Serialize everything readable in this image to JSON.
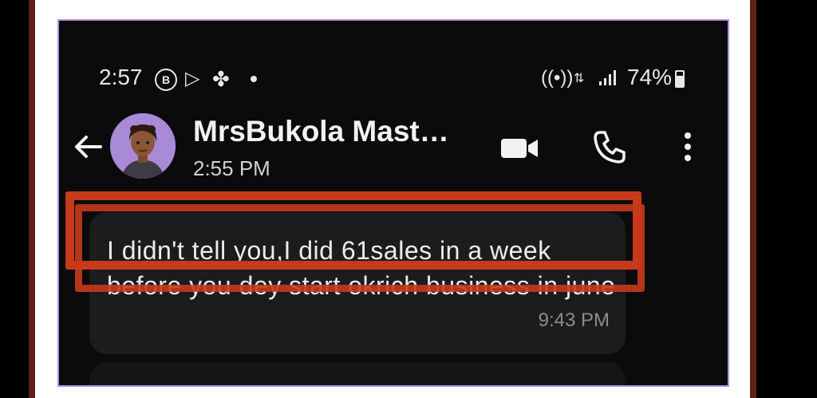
{
  "status_bar": {
    "time": "2:57",
    "notification_icons": [
      "b-circle-icon",
      "play-store-icon",
      "fan-icon",
      "dot-icon"
    ],
    "system_icons": [
      "hotspot-icon",
      "data-arrows-icon",
      "signal-icon"
    ],
    "battery_percent": "74%",
    "battery_level": 0.74
  },
  "chat_header": {
    "contact_name": "MrsBukola Mast…",
    "last_seen": "2:55 PM"
  },
  "message": {
    "text": "I didn't tell you,I did 61sales in a week before you dey start okrich business in june",
    "time": "9:43 PM"
  },
  "colors": {
    "highlight": "#c73a1c",
    "avatar_bg": "#a88ad6",
    "bubble_bg": "#1c1c1f",
    "screen_border": "#b48fe0"
  }
}
